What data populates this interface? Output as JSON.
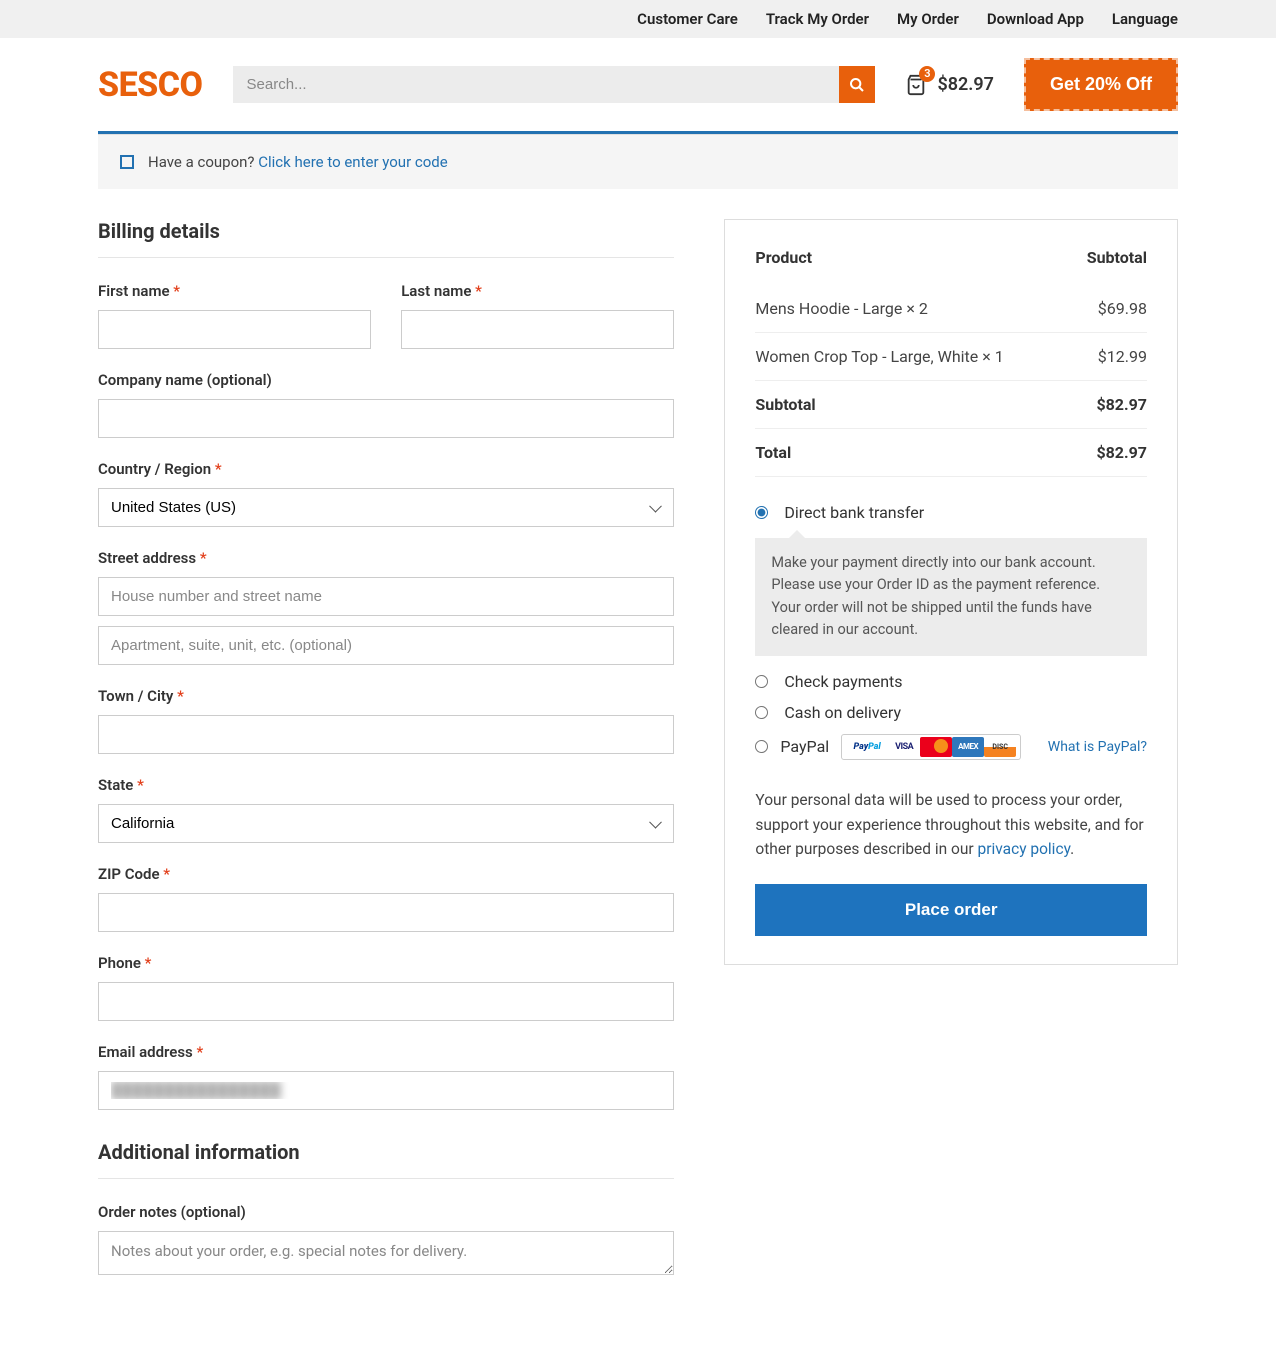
{
  "topbar": {
    "links": [
      "Customer Care",
      "Track My Order",
      "My Order",
      "Download App",
      "Language"
    ]
  },
  "header": {
    "logo": "SESCO",
    "search_placeholder": "Search...",
    "cart_count": "3",
    "cart_total": "$82.97",
    "promo": "Get 20% Off"
  },
  "coupon": {
    "prompt": "Have a coupon?",
    "link": "Click here to enter your code"
  },
  "billing": {
    "heading": "Billing details",
    "first_name": "First name",
    "last_name": "Last name",
    "company": "Company name (optional)",
    "country": "Country / Region",
    "country_value": "United States (US)",
    "street": "Street address",
    "street_ph1": "House number and street name",
    "street_ph2": "Apartment, suite, unit, etc. (optional)",
    "city": "Town / City",
    "state": "State",
    "state_value": "California",
    "zip": "ZIP Code",
    "phone": "Phone",
    "email": "Email address",
    "email_value": "████████████████"
  },
  "additional": {
    "heading": "Additional information",
    "notes_label": "Order notes (optional)",
    "notes_ph": "Notes about your order, e.g. special notes for delivery."
  },
  "order": {
    "product_head": "Product",
    "subtotal_head": "Subtotal",
    "items": [
      {
        "name": "Mens Hoodie - Large × 2",
        "price": "$69.98"
      },
      {
        "name": "Women Crop Top - Large, White × 1",
        "price": "$12.99"
      }
    ],
    "subtotal_label": "Subtotal",
    "subtotal_value": "$82.97",
    "total_label": "Total",
    "total_value": "$82.97"
  },
  "payment": {
    "bank": "Direct bank transfer",
    "bank_desc": "Make your payment directly into our bank account. Please use your Order ID as the payment reference. Your order will not be shipped until the funds have cleared in our account.",
    "check": "Check payments",
    "cod": "Cash on delivery",
    "paypal": "PayPal",
    "whatis": "What is PayPal?"
  },
  "privacy": {
    "text": "Your personal data will be used to process your order, support your experience throughout this website, and for other purposes described in our ",
    "link": "privacy policy",
    "period": "."
  },
  "place_order": "Place order",
  "required": "*"
}
